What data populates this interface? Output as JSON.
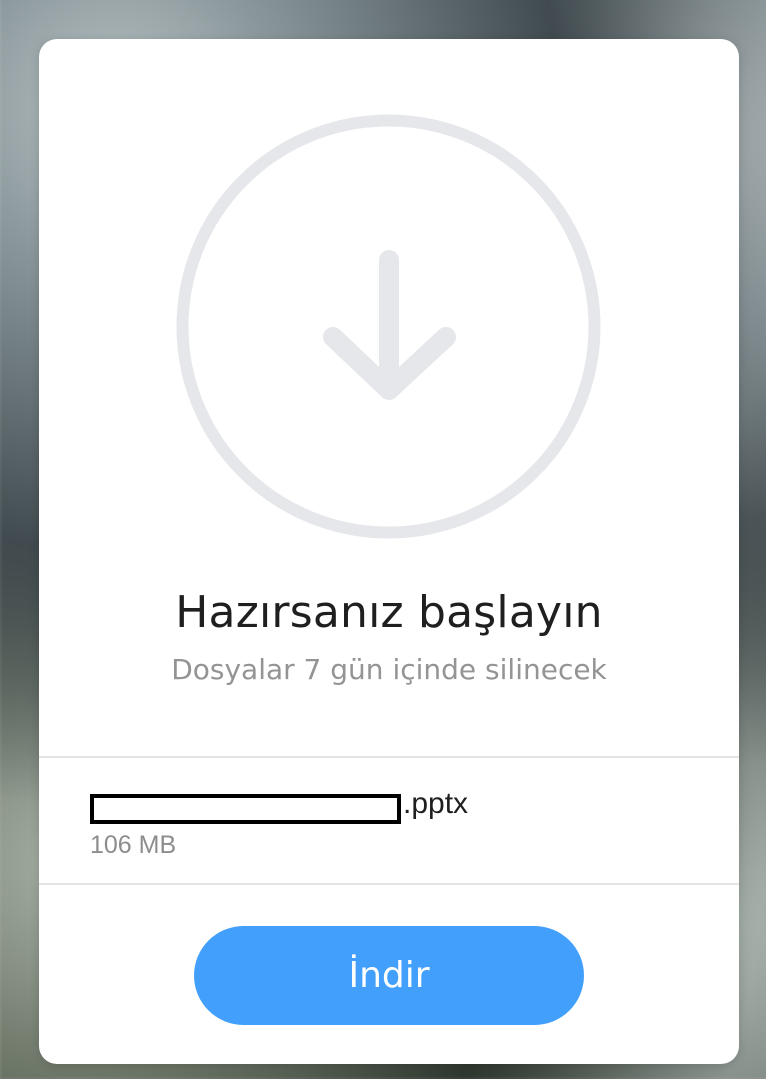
{
  "card": {
    "title": "Hazırsanız başlayın",
    "subtitle": "Dosyalar 7 gün içinde silinecek"
  },
  "file": {
    "name_redacted": true,
    "extension": ".pptx",
    "size": "106 MB"
  },
  "actions": {
    "download_label": "İndir"
  },
  "icons": {
    "main": "download-arrow-icon"
  },
  "colors": {
    "accent": "#42a0fc",
    "icon_gray": "#e6e7ea",
    "title": "#1f1f1f",
    "muted": "#949494"
  }
}
